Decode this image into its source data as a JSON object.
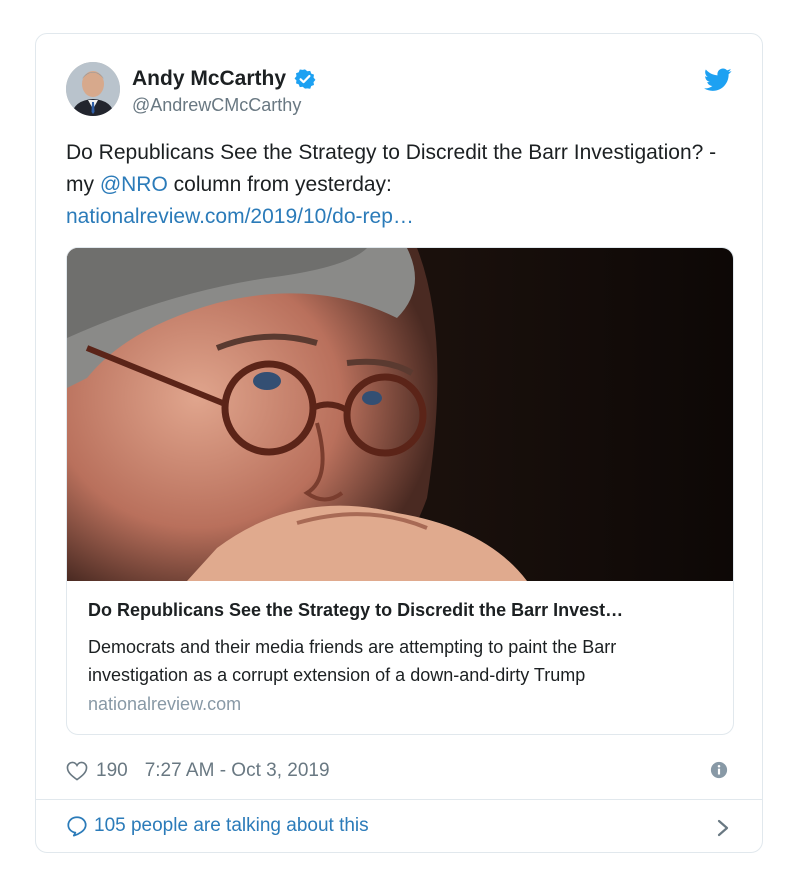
{
  "author": {
    "name": "Andy McCarthy",
    "handle": "@AndrewCMcCarthy"
  },
  "tweet": {
    "text_part1": "Do Republicans See the Strategy to Discredit the Barr Investigation? - my ",
    "mention": "@NRO",
    "text_part2": " column from yesterday:",
    "url": "nationalreview.com/2019/10/do-rep…"
  },
  "link_card": {
    "title": "Do Republicans See the Strategy to Discredit the Barr Invest…",
    "description": "Democrats and their media friends are attempting to paint the Barr investigation as a corrupt extension of a down-and-dirty Trump",
    "domain": "nationalreview.com"
  },
  "meta": {
    "likes": "190",
    "timestamp": "7:27 AM - Oct 3, 2019"
  },
  "footer": {
    "talking": "105 people are talking about this"
  },
  "icons": {
    "verified": "verified-badge-icon",
    "brand": "twitter-bird-icon",
    "like": "heart-icon",
    "info": "info-icon",
    "reply": "speech-bubble-icon",
    "more": "chevron-right-icon"
  },
  "colors": {
    "brand": "#1da1f2",
    "link": "#2b7bb9",
    "text": "#1c2022",
    "muted": "#697882",
    "border": "#e1e8ed"
  }
}
